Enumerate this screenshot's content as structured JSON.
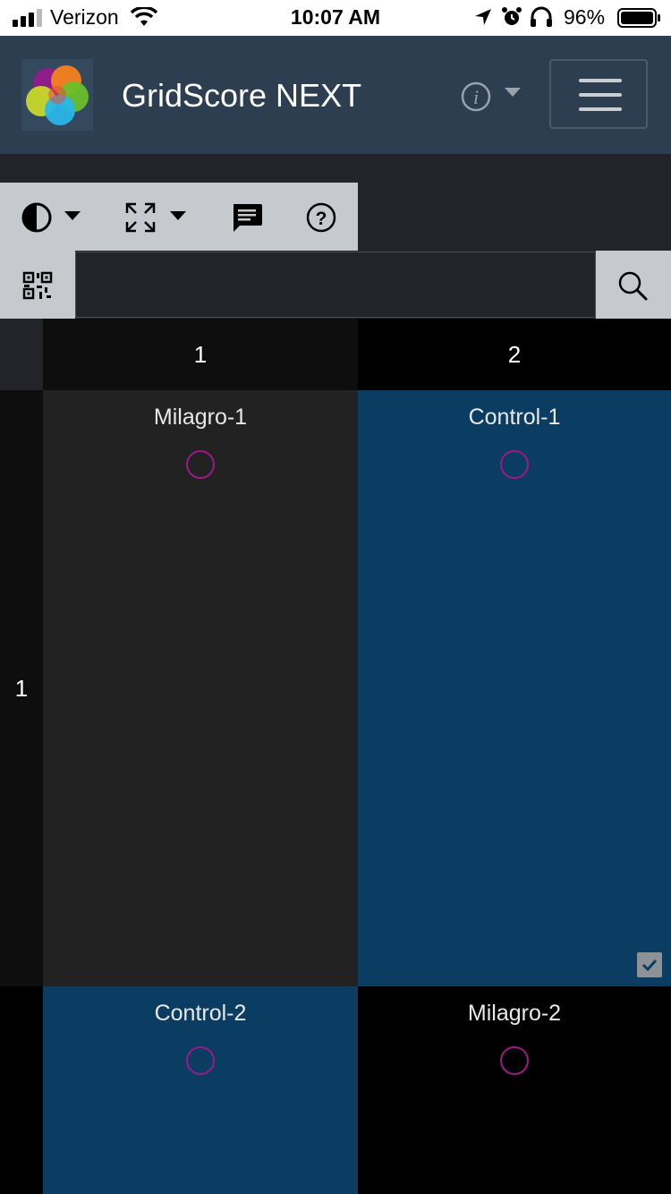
{
  "status_bar": {
    "carrier": "Verizon",
    "time": "10:07 AM",
    "battery": "96%"
  },
  "navbar": {
    "title": "GridScore NEXT",
    "info_icon": "info-icon",
    "menu_icon": "hamburger-icon"
  },
  "toolbar": {
    "icons": [
      "contrast-icon",
      "expand-icon",
      "comment-icon",
      "help-icon"
    ]
  },
  "search": {
    "placeholder": "",
    "value": ""
  },
  "grid": {
    "column_headers": [
      "1",
      "2"
    ],
    "row_headers": [
      "1"
    ],
    "cells": [
      {
        "name": "Milagro-1",
        "color": "#222222"
      },
      {
        "name": "Control-1",
        "color": "#0b3d63",
        "checked": true
      },
      {
        "name": "Control-2",
        "color": "#0b3d63"
      },
      {
        "name": "Milagro-2",
        "color": "#000000"
      }
    ]
  },
  "colors": {
    "navbar": "#2c3e50",
    "toolbar": "#c6cacf",
    "marker": "#9b1a8a",
    "highlight_cell": "#0b3d63"
  }
}
